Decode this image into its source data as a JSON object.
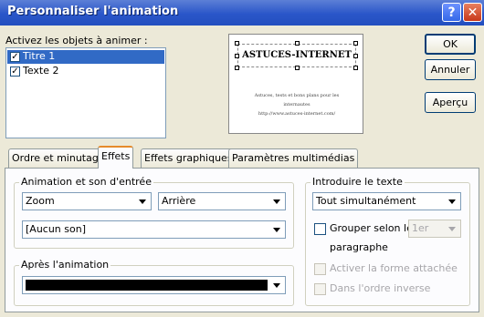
{
  "window": {
    "title": "Personnaliser l'animation",
    "help_label": "?",
    "close_label": "✕"
  },
  "objects": {
    "label": "Activez les objets à animer :",
    "items": [
      {
        "label": "Titre 1",
        "checked": true,
        "selected": true
      },
      {
        "label": "Texte 2",
        "checked": true,
        "selected": false
      }
    ]
  },
  "preview": {
    "heading": "ASTUCES-INTERNET",
    "line1": "Astuces, tests et bons plans pour les",
    "line2": "internautes",
    "line3": "http://www.astuces-internet.com/"
  },
  "buttons": {
    "ok": "OK",
    "cancel": "Annuler",
    "preview": "Aperçu"
  },
  "tabs": [
    {
      "label": "Ordre et minutage",
      "active": false
    },
    {
      "label": "Effets",
      "active": true
    },
    {
      "label": "Effets graphiques",
      "active": false
    },
    {
      "label": "Paramètres multimédias",
      "active": false
    }
  ],
  "entry": {
    "label": "Animation et son d'entrée",
    "effect": "Zoom",
    "direction": "Arrière",
    "sound": "[Aucun son]"
  },
  "after": {
    "label": "Après l'animation",
    "color": "#000000"
  },
  "intro": {
    "label": "Introduire le texte",
    "mode": "Tout simultanément",
    "group_label": "Grouper selon le",
    "group_level": "1er",
    "paragraph": "paragraphe",
    "attached_label": "Activer la forme attachée",
    "reverse_label": "Dans l'ordre inverse"
  }
}
